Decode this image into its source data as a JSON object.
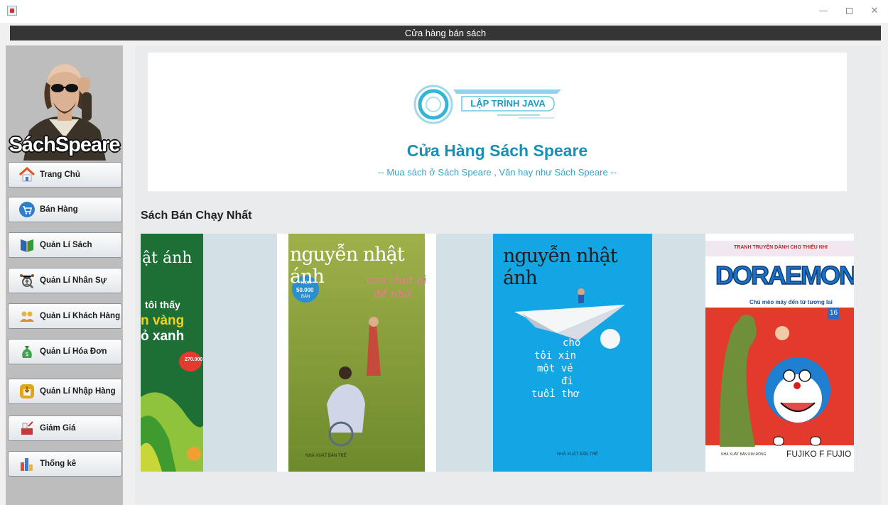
{
  "window": {
    "title": "Cửa hàng bán sách",
    "controls": {
      "minimize": "—",
      "close": "✕"
    }
  },
  "sidebar": {
    "logo_text": "SáchSpeare",
    "items": [
      {
        "label": "Trang Chủ",
        "icon": "home-icon"
      },
      {
        "label": "Bán Hàng",
        "icon": "cart-icon"
      },
      {
        "label": "Quản Lí Sách",
        "icon": "book-icon"
      },
      {
        "label": "Quản Lí Nhân Sự",
        "icon": "staff-icon"
      },
      {
        "label": "Quản Lí Khách Hàng",
        "icon": "customers-icon"
      },
      {
        "label": "Quản Lí Hóa Đơn",
        "icon": "money-bag-icon"
      },
      {
        "label": "Quản Lí Nhập Hàng",
        "icon": "import-icon"
      },
      {
        "label": "Giảm Giá",
        "icon": "discount-icon"
      },
      {
        "label": "Thống kê",
        "icon": "statistics-icon"
      }
    ]
  },
  "banner": {
    "logo_text": "LẬP TRÌNH JAVA",
    "title": "Cửa Hàng Sách Speare",
    "subtitle": "-- Mua sách ở Sách Speare , Văn hay như Sách Speare --"
  },
  "bestsellers": {
    "title": "Sách Bán Chạy Nhất",
    "books": [
      {
        "author_fragment": "ật ánh",
        "title_lines": [
          "tôi thấy",
          "n vàng",
          "ỏ xanh"
        ],
        "badge": "270.000"
      },
      {
        "author": "nguyễn nhật ánh",
        "title_lines": [
          "con chút gì",
          "để nhớ"
        ],
        "badge_top": "HƠN",
        "badge": "50.000",
        "badge_bottom": "BẢN",
        "publisher": "NHÀ XUẤT BẢN TRẺ"
      },
      {
        "author": "nguyễn nhật ánh",
        "title_lines": [
          "cho",
          "tôi xin",
          "một vé",
          "đi",
          "tuổi thơ"
        ],
        "publisher": "NHÀ XUẤT BẢN TRẺ"
      },
      {
        "series": "TRANH TRUYỆN DÀNH CHO THIẾU NHI",
        "title": "DORAEMON",
        "subtitle": "Chú mèo máy đến từ tương lai",
        "volume": "16",
        "author": "FUJIKO F FUJIO",
        "publisher": "NHÀ XUẤT BẢN KIM ĐỒNG"
      }
    ]
  },
  "colors": {
    "header_bar": "#353535",
    "sidebar_bg": "#bdbdbd",
    "accent": "#1b8fb6"
  }
}
